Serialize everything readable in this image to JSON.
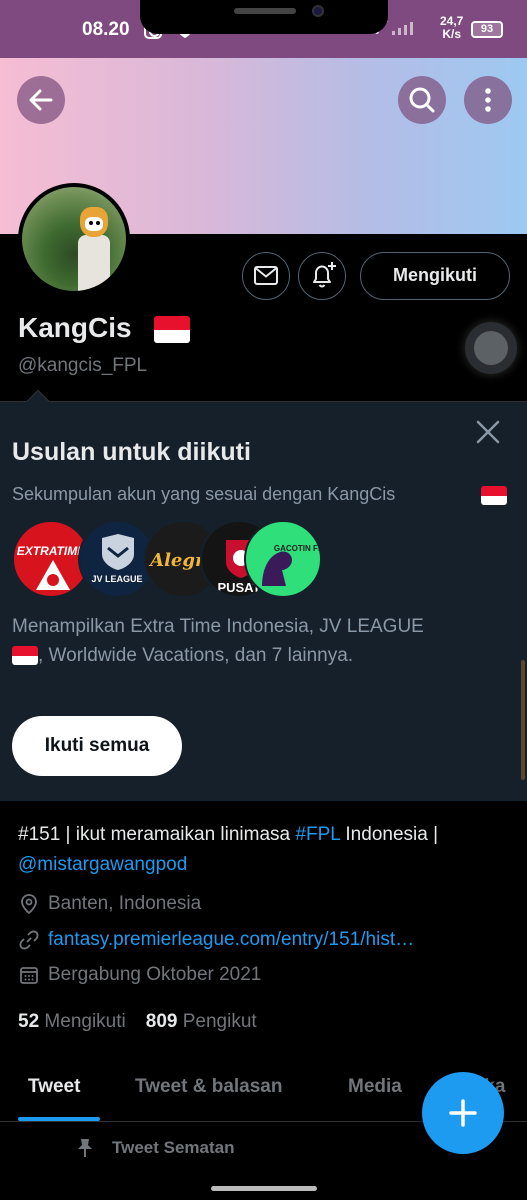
{
  "status_bar": {
    "time": "08.20",
    "net_speed_value": "24,7",
    "net_speed_unit": "K/s",
    "battery": "93"
  },
  "icons": {
    "back": "arrow-left-icon",
    "search": "search-icon",
    "more": "more-vertical-icon",
    "message": "mail-icon",
    "notify": "bell-plus-icon",
    "close": "close-icon",
    "location": "location-pin-icon",
    "link": "link-icon",
    "calendar": "calendar-icon",
    "pin": "pin-icon",
    "compose": "plus-icon"
  },
  "profile": {
    "display_name": "KangCis",
    "handle": "@kangcis_FPL",
    "follow_label": "Mengikuti"
  },
  "suggestions": {
    "title": "Usulan untuk diikuti",
    "subtitle": "Sekumpulan akun yang sesuai dengan KangCis",
    "avatars": [
      {
        "label": "EXTRATIME"
      },
      {
        "label": "JV LEAGUE"
      },
      {
        "label": "Alegre"
      },
      {
        "label": "PUSAT"
      },
      {
        "label": "GACOTIN FPL"
      }
    ],
    "description_line1": "Menampilkan Extra Time Indonesia, JV LEAGUE",
    "description_line2": ", Worldwide Vacations, dan 7 lainnya.",
    "follow_all_label": "Ikuti semua"
  },
  "bio": {
    "part1": "#151 | ikut meramaikan linimasa ",
    "hashtag": "#FPL",
    "part2": " Indonesia |",
    "mention": "@mistargawangpod",
    "location": "Banten, Indonesia",
    "url": "fantasy.premierleague.com/entry/151/hist…",
    "joined": "Bergabung Oktober 2021"
  },
  "stats": {
    "following_count": "52",
    "following_label": "Mengikuti",
    "followers_count": "809",
    "followers_label": "Pengikut"
  },
  "tabs": [
    {
      "label": "Tweet"
    },
    {
      "label": "Tweet & balasan"
    },
    {
      "label": "Media"
    },
    {
      "label": "Suka"
    }
  ],
  "pinned_label": "Tweet Sematan",
  "colors": {
    "accent": "#1d9bf0",
    "status_bar": "#7e4a7f",
    "suggestion_bg": "#15202b"
  }
}
